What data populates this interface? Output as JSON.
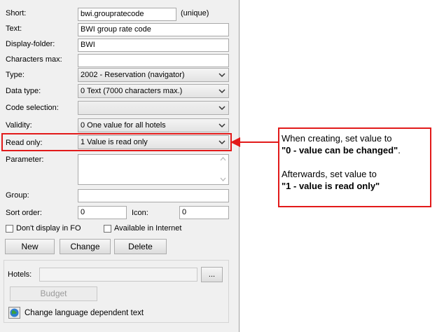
{
  "form": {
    "short": {
      "label": "Short:",
      "value": "bwi.grouprate​code",
      "suffix": "(unique)"
    },
    "text": {
      "label": "Text:",
      "value": "BWI group rate code"
    },
    "display_folder": {
      "label": "Display-folder:",
      "value": "BWI"
    },
    "characters_max": {
      "label": "Characters max:",
      "value": ""
    },
    "type": {
      "label": "Type:",
      "value": "2002 - Reservation (navigator)"
    },
    "data_type": {
      "label": "Data type:",
      "value": "0 Text (7000 characters max.)"
    },
    "code_selection": {
      "label": "Code selection:",
      "value": ""
    },
    "validity": {
      "label": "Validity:",
      "value": "0 One value for all hotels"
    },
    "read_only": {
      "label": "Read only:",
      "value": "1 Value is read only"
    },
    "parameter": {
      "label": "Parameter:",
      "value": ""
    },
    "group": {
      "label": "Group:",
      "value": ""
    },
    "sort_order": {
      "label": "Sort order:",
      "value": "0"
    },
    "icon": {
      "label": "Icon:",
      "value": "0"
    },
    "dont_display_fo": {
      "label": "Don't display in FO",
      "checked": false
    },
    "available_internet": {
      "label": "Available in Internet",
      "checked": false
    }
  },
  "buttons": {
    "new": "New",
    "change": "Change",
    "delete": "Delete"
  },
  "hotels_section": {
    "hotels_label": "Hotels:",
    "hotels_value": "",
    "browse_label": "...",
    "budget_label": "Budget",
    "language_link": "Change language dependent text"
  },
  "annotation": {
    "line1": "When creating, set value to",
    "line2": "\"0 - value can be changed\"",
    "line2_end": ".",
    "line3": "Afterwards, set value to",
    "line4": "\"1 - value is read only\"",
    "color": "#e21a1a"
  }
}
